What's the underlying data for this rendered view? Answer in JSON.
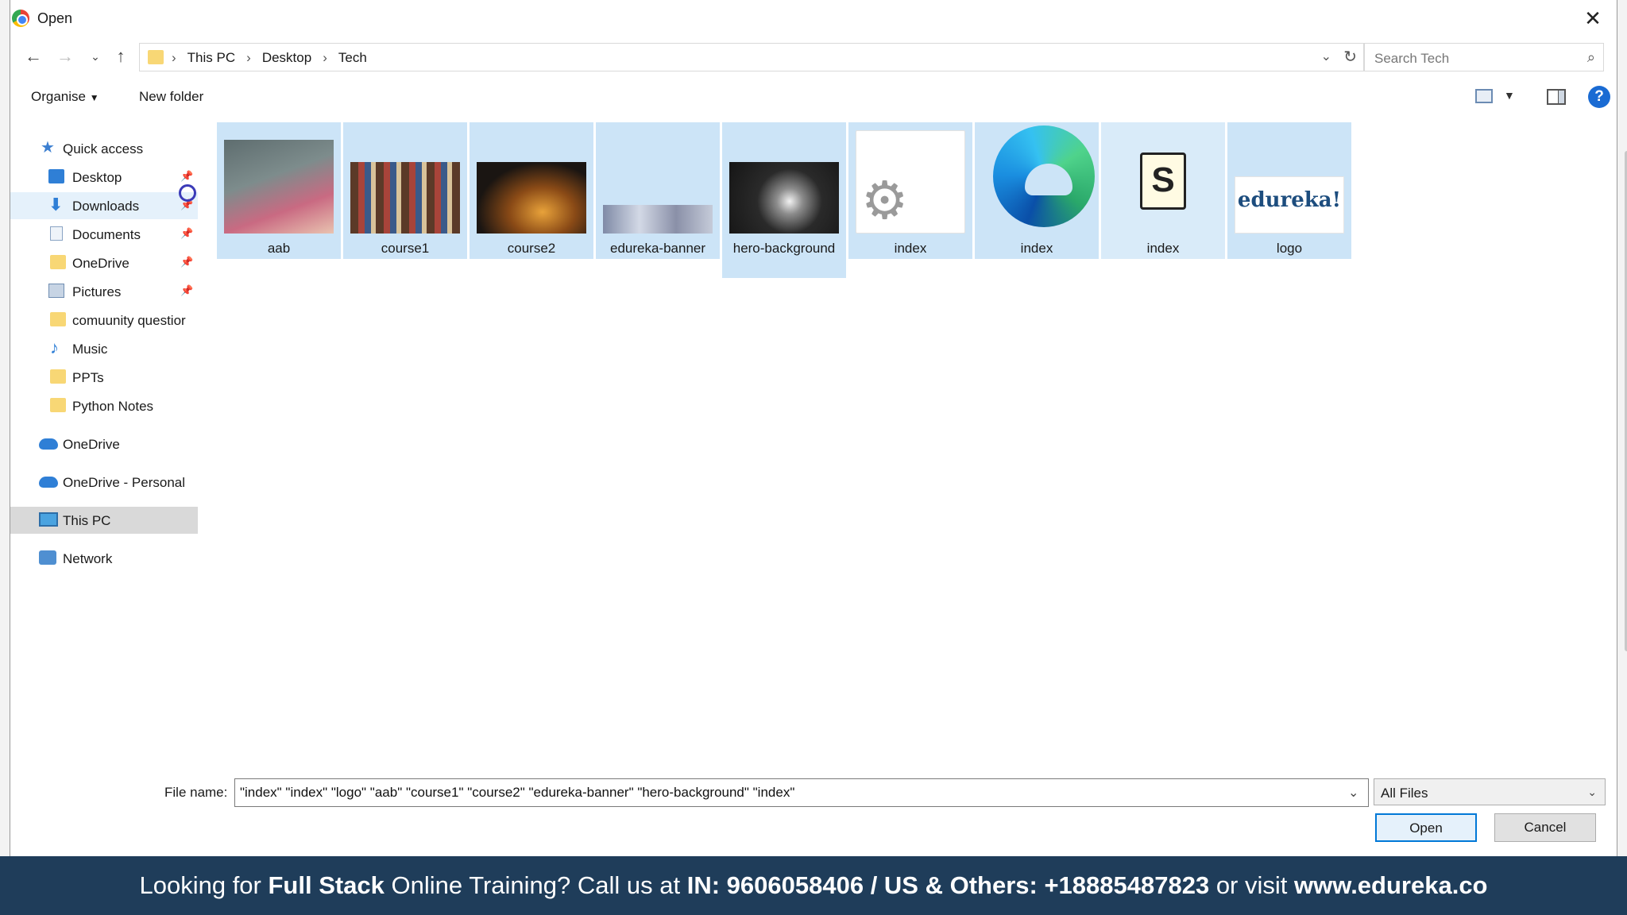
{
  "window": {
    "title": "Open"
  },
  "address": {
    "crumbs": [
      "This PC",
      "Desktop",
      "Tech"
    ],
    "search_placeholder": "Search Tech"
  },
  "toolbar": {
    "organise_label": "Organise",
    "new_folder_label": "New folder",
    "help_icon": "?"
  },
  "sidebar": {
    "items": [
      {
        "label": "Quick access",
        "icon": "star-icon"
      },
      {
        "label": "Desktop",
        "icon": "desktop-icon",
        "pinned": true
      },
      {
        "label": "Downloads",
        "icon": "download-icon",
        "pinned": true
      },
      {
        "label": "Documents",
        "icon": "documents-icon",
        "pinned": true
      },
      {
        "label": "OneDrive",
        "icon": "folder-icon",
        "pinned": true
      },
      {
        "label": "Pictures",
        "icon": "pictures-icon",
        "pinned": true
      },
      {
        "label": "comuunity questior",
        "icon": "folder-icon"
      },
      {
        "label": "Music",
        "icon": "music-icon"
      },
      {
        "label": "PPTs",
        "icon": "folder-icon"
      },
      {
        "label": "Python Notes",
        "icon": "folder-icon"
      },
      {
        "label": "OneDrive",
        "icon": "cloud-icon"
      },
      {
        "label": "OneDrive - Personal",
        "icon": "cloud-icon"
      },
      {
        "label": "This PC",
        "icon": "computer-icon",
        "selected": true
      },
      {
        "label": "Network",
        "icon": "network-icon"
      }
    ]
  },
  "files": [
    {
      "name": "aab",
      "type": "image"
    },
    {
      "name": "course1",
      "type": "image"
    },
    {
      "name": "course2",
      "type": "image"
    },
    {
      "name": "edureka-banner",
      "type": "image"
    },
    {
      "name": "hero-background",
      "type": "image"
    },
    {
      "name": "index",
      "type": "settings-file"
    },
    {
      "name": "index",
      "type": "edge-html"
    },
    {
      "name": "index",
      "type": "script"
    },
    {
      "name": "logo",
      "type": "image",
      "logo_text": "edureka!"
    }
  ],
  "footer": {
    "file_name_label": "File name:",
    "file_name_value": "\"index\" \"index\" \"logo\" \"aab\" \"course1\" \"course2\" \"edureka-banner\" \"hero-background\" \"index\"",
    "file_type": "All Files",
    "open_label": "Open",
    "cancel_label": "Cancel"
  },
  "banner": {
    "t1": "Looking for ",
    "b1": "Full Stack",
    "t2": " Online Training? Call us at ",
    "b2": "IN: 9606058406 / US & Others: +18885487823",
    "t3": " or visit ",
    "b3": "www.edureka.co"
  },
  "colors": {
    "selection": "#cce4f7",
    "banner_bg": "#1f3d5a",
    "accent": "#0078d7"
  }
}
